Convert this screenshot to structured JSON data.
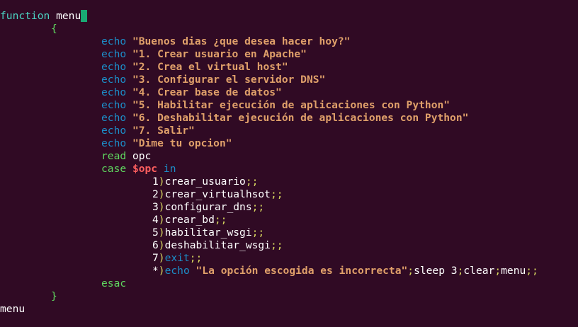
{
  "terminal": {
    "line_function": {
      "kw": "function",
      "name": " menu"
    },
    "open_brace": "{",
    "echoes": [
      {
        "cmd": "echo",
        "text": "\"Buenos dias ¿que desea hacer hoy?\""
      },
      {
        "cmd": "echo",
        "text": "\"1. Crear usuario en Apache\""
      },
      {
        "cmd": "echo",
        "text": "\"2. Crea el virtual host\""
      },
      {
        "cmd": "echo",
        "text": "\"3. Configurar el servidor DNS\""
      },
      {
        "cmd": "echo",
        "text": "\"4. Crear base de datos\""
      },
      {
        "cmd": "echo",
        "text": "\"5. Habilitar ejecución de aplicaciones con Python\""
      },
      {
        "cmd": "echo",
        "text": "\"6. Deshabilitar ejecución de aplicaciones con Python\""
      },
      {
        "cmd": "echo",
        "text": "\"7. Salir\""
      },
      {
        "cmd": "echo",
        "text": "\"Dime tu opcion\""
      }
    ],
    "read_line": {
      "cmd": "read",
      "arg": " opc"
    },
    "case_line": {
      "kw": "case",
      "var": "$opc",
      "in": "in"
    },
    "cases": [
      {
        "num": "1",
        "paren": ")",
        "action": "crear_usuario",
        "end": ";;"
      },
      {
        "num": "2",
        "paren": ")",
        "action": "crear_virtualhsot",
        "end": ";;"
      },
      {
        "num": "3",
        "paren": ")",
        "action": "configurar_dns",
        "end": ";;"
      },
      {
        "num": "4",
        "paren": ")",
        "action": "crear_bd",
        "end": ";;"
      },
      {
        "num": "5",
        "paren": ")",
        "action": "habilitar_wsgi",
        "end": ";;"
      },
      {
        "num": "6",
        "paren": ")",
        "action": "deshabilitar_wsgi",
        "end": ";;"
      }
    ],
    "case_exit": {
      "num": "7",
      "paren": ")",
      "action": "exit",
      "end": ";;"
    },
    "case_default": {
      "num": "*",
      "paren": ")",
      "cmd": "echo",
      "text": "\"La opción escogida es incorrecta\"",
      "sep1": ";",
      "sleep": "sleep 3",
      "sep2": ";",
      "clear": "clear",
      "sep3": ";",
      "menu": "menu",
      "end": ";;"
    },
    "esac": "esac",
    "close_brace": "}",
    "last_line": "menu"
  }
}
